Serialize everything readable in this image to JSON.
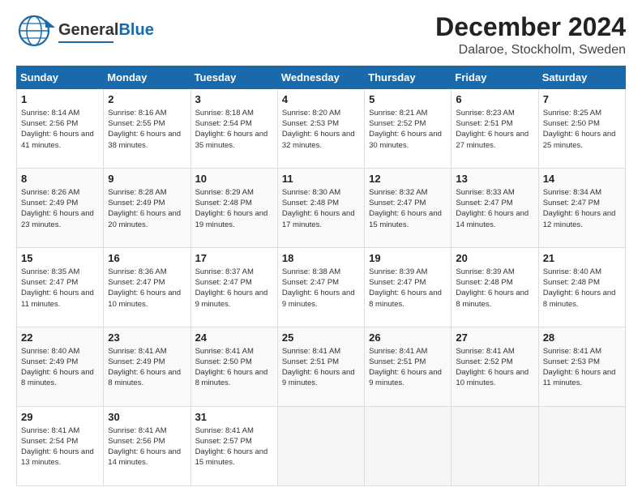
{
  "header": {
    "logo_general": "General",
    "logo_blue": "Blue",
    "main_title": "December 2024",
    "subtitle": "Dalaroe, Stockholm, Sweden"
  },
  "calendar": {
    "days_of_week": [
      "Sunday",
      "Monday",
      "Tuesday",
      "Wednesday",
      "Thursday",
      "Friday",
      "Saturday"
    ],
    "weeks": [
      [
        {
          "day": "1",
          "sunrise": "8:14 AM",
          "sunset": "2:56 PM",
          "daylight": "6 hours and 41 minutes."
        },
        {
          "day": "2",
          "sunrise": "8:16 AM",
          "sunset": "2:55 PM",
          "daylight": "6 hours and 38 minutes."
        },
        {
          "day": "3",
          "sunrise": "8:18 AM",
          "sunset": "2:54 PM",
          "daylight": "6 hours and 35 minutes."
        },
        {
          "day": "4",
          "sunrise": "8:20 AM",
          "sunset": "2:53 PM",
          "daylight": "6 hours and 32 minutes."
        },
        {
          "day": "5",
          "sunrise": "8:21 AM",
          "sunset": "2:52 PM",
          "daylight": "6 hours and 30 minutes."
        },
        {
          "day": "6",
          "sunrise": "8:23 AM",
          "sunset": "2:51 PM",
          "daylight": "6 hours and 27 minutes."
        },
        {
          "day": "7",
          "sunrise": "8:25 AM",
          "sunset": "2:50 PM",
          "daylight": "6 hours and 25 minutes."
        }
      ],
      [
        {
          "day": "8",
          "sunrise": "8:26 AM",
          "sunset": "2:49 PM",
          "daylight": "6 hours and 23 minutes."
        },
        {
          "day": "9",
          "sunrise": "8:28 AM",
          "sunset": "2:49 PM",
          "daylight": "6 hours and 20 minutes."
        },
        {
          "day": "10",
          "sunrise": "8:29 AM",
          "sunset": "2:48 PM",
          "daylight": "6 hours and 19 minutes."
        },
        {
          "day": "11",
          "sunrise": "8:30 AM",
          "sunset": "2:48 PM",
          "daylight": "6 hours and 17 minutes."
        },
        {
          "day": "12",
          "sunrise": "8:32 AM",
          "sunset": "2:47 PM",
          "daylight": "6 hours and 15 minutes."
        },
        {
          "day": "13",
          "sunrise": "8:33 AM",
          "sunset": "2:47 PM",
          "daylight": "6 hours and 14 minutes."
        },
        {
          "day": "14",
          "sunrise": "8:34 AM",
          "sunset": "2:47 PM",
          "daylight": "6 hours and 12 minutes."
        }
      ],
      [
        {
          "day": "15",
          "sunrise": "8:35 AM",
          "sunset": "2:47 PM",
          "daylight": "6 hours and 11 minutes."
        },
        {
          "day": "16",
          "sunrise": "8:36 AM",
          "sunset": "2:47 PM",
          "daylight": "6 hours and 10 minutes."
        },
        {
          "day": "17",
          "sunrise": "8:37 AM",
          "sunset": "2:47 PM",
          "daylight": "6 hours and 9 minutes."
        },
        {
          "day": "18",
          "sunrise": "8:38 AM",
          "sunset": "2:47 PM",
          "daylight": "6 hours and 9 minutes."
        },
        {
          "day": "19",
          "sunrise": "8:39 AM",
          "sunset": "2:47 PM",
          "daylight": "6 hours and 8 minutes."
        },
        {
          "day": "20",
          "sunrise": "8:39 AM",
          "sunset": "2:48 PM",
          "daylight": "6 hours and 8 minutes."
        },
        {
          "day": "21",
          "sunrise": "8:40 AM",
          "sunset": "2:48 PM",
          "daylight": "6 hours and 8 minutes."
        }
      ],
      [
        {
          "day": "22",
          "sunrise": "8:40 AM",
          "sunset": "2:49 PM",
          "daylight": "6 hours and 8 minutes."
        },
        {
          "day": "23",
          "sunrise": "8:41 AM",
          "sunset": "2:49 PM",
          "daylight": "6 hours and 8 minutes."
        },
        {
          "day": "24",
          "sunrise": "8:41 AM",
          "sunset": "2:50 PM",
          "daylight": "6 hours and 8 minutes."
        },
        {
          "day": "25",
          "sunrise": "8:41 AM",
          "sunset": "2:51 PM",
          "daylight": "6 hours and 9 minutes."
        },
        {
          "day": "26",
          "sunrise": "8:41 AM",
          "sunset": "2:51 PM",
          "daylight": "6 hours and 9 minutes."
        },
        {
          "day": "27",
          "sunrise": "8:41 AM",
          "sunset": "2:52 PM",
          "daylight": "6 hours and 10 minutes."
        },
        {
          "day": "28",
          "sunrise": "8:41 AM",
          "sunset": "2:53 PM",
          "daylight": "6 hours and 11 minutes."
        }
      ],
      [
        {
          "day": "29",
          "sunrise": "8:41 AM",
          "sunset": "2:54 PM",
          "daylight": "6 hours and 13 minutes."
        },
        {
          "day": "30",
          "sunrise": "8:41 AM",
          "sunset": "2:56 PM",
          "daylight": "6 hours and 14 minutes."
        },
        {
          "day": "31",
          "sunrise": "8:41 AM",
          "sunset": "2:57 PM",
          "daylight": "6 hours and 15 minutes."
        },
        null,
        null,
        null,
        null
      ]
    ]
  }
}
